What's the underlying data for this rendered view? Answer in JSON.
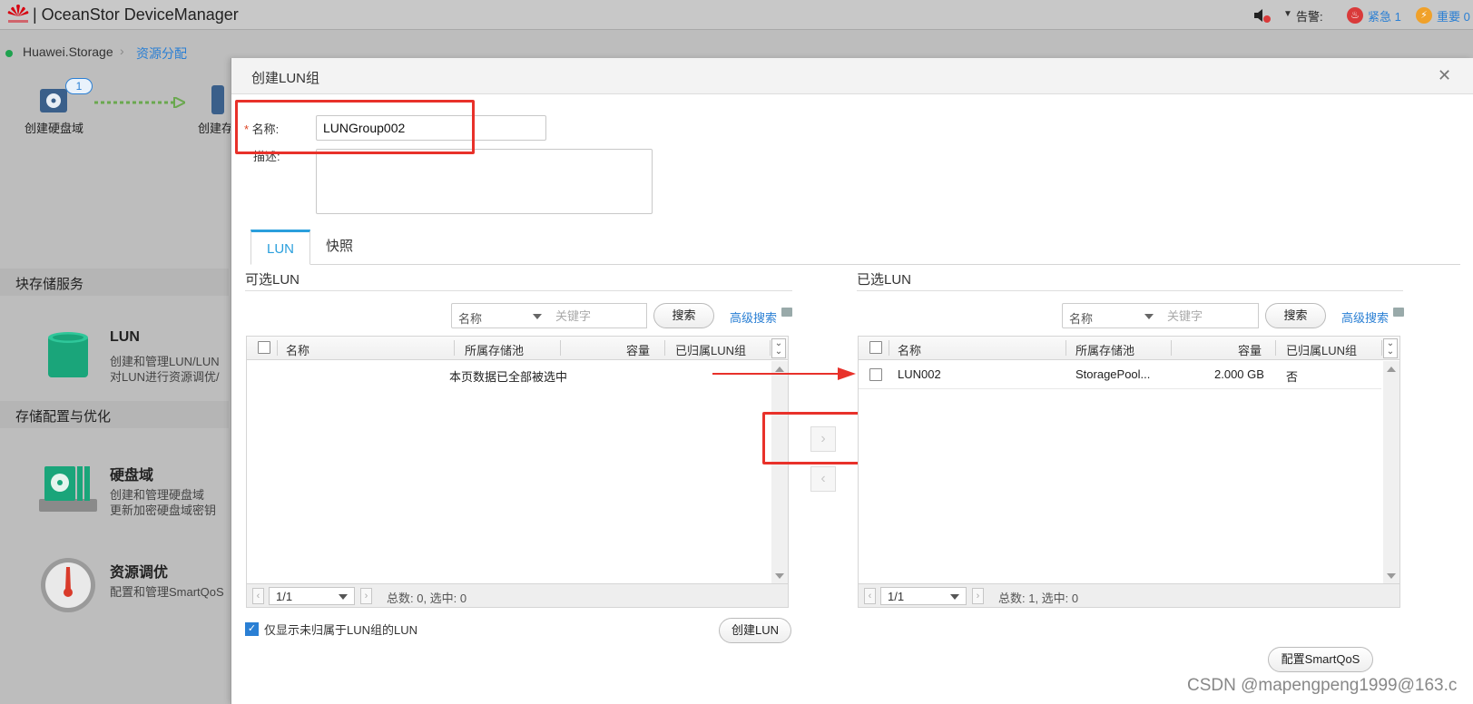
{
  "topbar": {
    "app_title": "| OceanStor DeviceManager",
    "alarm_label": "告警:",
    "urgent_label": "紧急 1",
    "major_label": "重要 0",
    "urgent_icon": "flame-icon",
    "major_icon": "lightning-icon"
  },
  "breadcrumb": {
    "root": "Huawei.Storage",
    "current": "资源分配"
  },
  "background": {
    "wizard_step1": "创建硬盘域",
    "wizard_step1_badge": "1",
    "wizard_step2": "创建存",
    "section_block": "块存储服务",
    "section_config": "存储配置与优化",
    "cards": [
      {
        "title": "LUN",
        "desc1": "创建和管理LUN/LUN",
        "desc2": "对LUN进行资源调优/"
      },
      {
        "title": "硬盘域",
        "desc1": "创建和管理硬盘域",
        "desc2": "更新加密硬盘域密钥"
      },
      {
        "title": "资源调优",
        "desc1": "配置和管理SmartQoS",
        "desc2": ""
      }
    ]
  },
  "dialog": {
    "title": "创建LUN组",
    "close_icon": "close-icon",
    "name_label": "名称:",
    "name_value": "LUNGroup002",
    "desc_label": "描述:",
    "desc_value": "",
    "tabs": [
      {
        "label": "LUN",
        "active": true
      },
      {
        "label": "快照",
        "active": false
      }
    ],
    "available": {
      "title": "可选LUN",
      "filter_field": "名称",
      "keyword_placeholder": "关键字",
      "search_label": "搜索",
      "advanced_label": "高级搜索",
      "columns": [
        "名称",
        "所属存储池",
        "容量",
        "已归属LUN组"
      ],
      "empty_message": "本页数据已全部被选中",
      "rows": [],
      "page": "1/1",
      "summary": "总数: 0, 选中: 0"
    },
    "selected": {
      "title": "已选LUN",
      "filter_field": "名称",
      "keyword_placeholder": "关键字",
      "search_label": "搜索",
      "advanced_label": "高级搜索",
      "columns": [
        "名称",
        "所属存储池",
        "容量",
        "已归属LUN组"
      ],
      "rows": [
        {
          "name": "LUN002",
          "pool": "StoragePool...",
          "capacity": "2.000 GB",
          "in_group": "否"
        }
      ],
      "page": "1/1",
      "summary": "总数: 1, 选中: 0"
    },
    "move_right_icon": "chevron-right-icon",
    "move_left_icon": "chevron-left-icon",
    "only_unassigned_label": "仅显示未归属于LUN组的LUN",
    "only_unassigned_checked": true,
    "create_lun_label": "创建LUN",
    "smartqos_label": "配置SmartQoS"
  },
  "watermark": "CSDN @mapengpeng1999@163.c",
  "colors": {
    "accent": "#2a9fdc",
    "link": "#2a7fd4",
    "highlight_red": "#e8312a"
  }
}
